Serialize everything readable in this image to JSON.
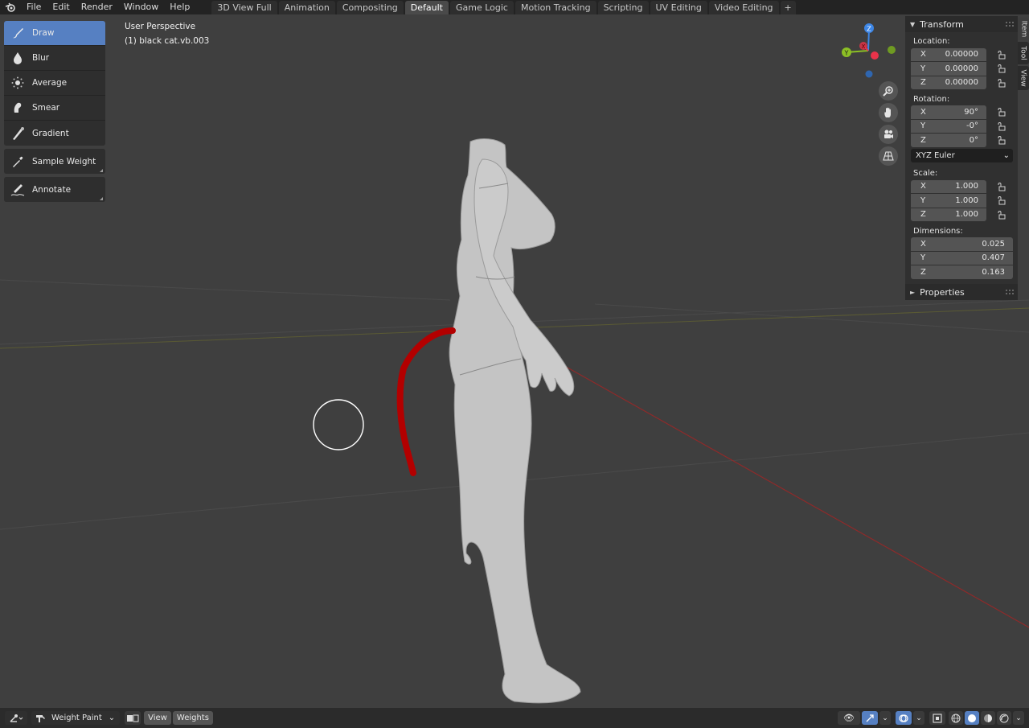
{
  "topbar": {
    "menus": [
      "File",
      "Edit",
      "Render",
      "Window",
      "Help"
    ],
    "tabs": [
      "3D View Full",
      "Animation",
      "Compositing",
      "Default",
      "Game Logic",
      "Motion Tracking",
      "Scripting",
      "UV Editing",
      "Video Editing"
    ],
    "active_tab": "Default",
    "add_tab": "+"
  },
  "viewport": {
    "view_name": "User Perspective",
    "object_name": "(1) black cat.vb.003"
  },
  "toolshelf": {
    "tools": [
      {
        "label": "Draw",
        "icon": "brush-icon",
        "active": true
      },
      {
        "label": "Blur",
        "icon": "drop-icon",
        "active": false
      },
      {
        "label": "Average",
        "icon": "average-icon",
        "active": false
      },
      {
        "label": "Smear",
        "icon": "smear-icon",
        "active": false
      },
      {
        "label": "Gradient",
        "icon": "gradient-icon",
        "active": false
      }
    ],
    "sample_weight": "Sample Weight",
    "annotate": "Annotate"
  },
  "gizmo": {
    "z": "Z",
    "y": "Y",
    "x": "X",
    "colors": {
      "x": "#e8334a",
      "y": "#8cbf25",
      "z": "#3d86e6"
    }
  },
  "sidetabs": [
    "Item",
    "Tool",
    "View"
  ],
  "npanel": {
    "transform_title": "Transform",
    "location_label": "Location:",
    "location": [
      {
        "axis": "X",
        "value": "0.00000"
      },
      {
        "axis": "Y",
        "value": "0.00000"
      },
      {
        "axis": "Z",
        "value": "0.00000"
      }
    ],
    "rotation_label": "Rotation:",
    "rotation": [
      {
        "axis": "X",
        "value": "90°"
      },
      {
        "axis": "Y",
        "value": "-0°"
      },
      {
        "axis": "Z",
        "value": "0°"
      }
    ],
    "rotation_mode": "XYZ Euler",
    "scale_label": "Scale:",
    "scale": [
      {
        "axis": "X",
        "value": "1.000"
      },
      {
        "axis": "Y",
        "value": "1.000"
      },
      {
        "axis": "Z",
        "value": "1.000"
      }
    ],
    "dimensions_label": "Dimensions:",
    "dimensions": [
      {
        "axis": "X",
        "value": "0.025"
      },
      {
        "axis": "Y",
        "value": "0.407"
      },
      {
        "axis": "Z",
        "value": "0.163"
      }
    ],
    "properties_title": "Properties"
  },
  "bottombar": {
    "mode": "Weight Paint",
    "view_menu": "View",
    "weights_menu": "Weights"
  },
  "colors": {
    "active_tool": "#5680c2",
    "tail": "#b30000",
    "viewport_bg": "#3f3f3f"
  }
}
